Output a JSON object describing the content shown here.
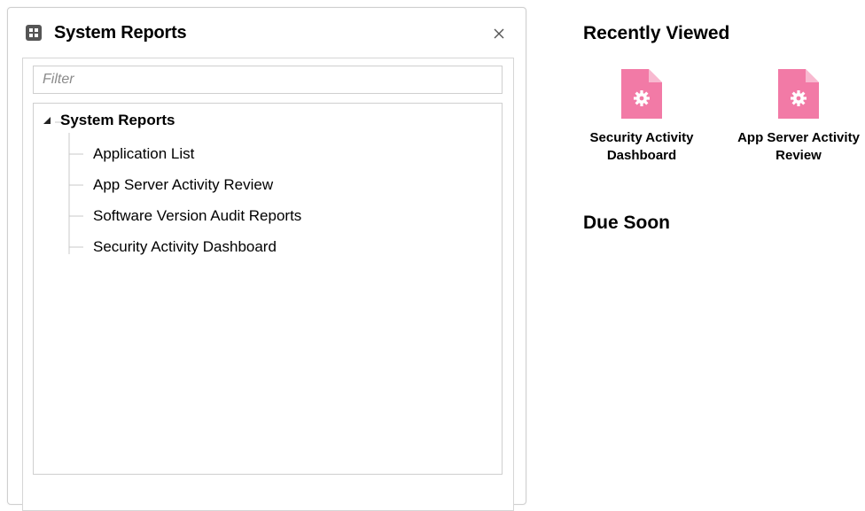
{
  "colors": {
    "accent_pink": "#f27aa6",
    "border": "#cfcfcf",
    "tree_line": "#c8c8c8"
  },
  "panel": {
    "title": "System Reports",
    "title_icon": "grid-icon",
    "close_icon": "close-icon",
    "filter": {
      "placeholder": "Filter",
      "value": ""
    },
    "tree": {
      "root": {
        "label": "System Reports",
        "expanded": true,
        "expander_icon": "triangle-down-icon"
      },
      "items": [
        {
          "label": "Application List"
        },
        {
          "label": "App Server Activity Review"
        },
        {
          "label": "Software Version Audit Reports"
        },
        {
          "label": "Security Activity Dashboard"
        }
      ]
    }
  },
  "recently_viewed": {
    "title": "Recently Viewed",
    "items": [
      {
        "label": "Security Activity\nDashboard",
        "icon": "report-gear-icon"
      },
      {
        "label": "App Server Activity\nReview",
        "icon": "report-gear-icon"
      }
    ]
  },
  "due_soon": {
    "title": "Due Soon"
  }
}
